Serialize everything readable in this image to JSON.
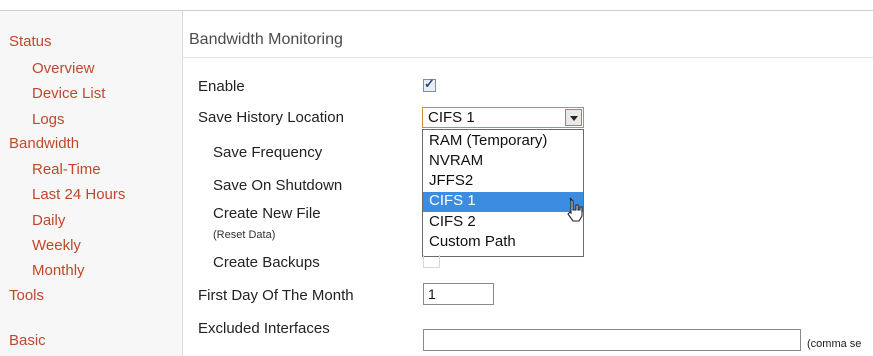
{
  "sidebar": {
    "items": [
      {
        "label": "Status"
      },
      {
        "label": "Overview"
      },
      {
        "label": "Device List"
      },
      {
        "label": "Logs"
      },
      {
        "label": "Bandwidth"
      },
      {
        "label": "Real-Time"
      },
      {
        "label": "Last 24 Hours"
      },
      {
        "label": "Daily"
      },
      {
        "label": "Weekly"
      },
      {
        "label": "Monthly"
      },
      {
        "label": "Tools"
      },
      {
        "label": "Basic"
      }
    ]
  },
  "main": {
    "section_title": "Bandwidth Monitoring",
    "fields": {
      "enable_label": "Enable",
      "enable_checked": true,
      "save_history_label": "Save History Location",
      "save_frequency_label": "Save Frequency",
      "save_on_shutdown_label": "Save On Shutdown",
      "create_new_file_label": "Create New File",
      "create_new_file_sub": "(Reset Data)",
      "create_backups_label": "Create Backups",
      "first_day_label": "First Day Of The Month",
      "first_day_value": "1",
      "excluded_label": "Excluded Interfaces",
      "excluded_value": "",
      "excluded_hint": "(comma se"
    },
    "save_history_select": {
      "selected": "CIFS 1",
      "options": [
        "RAM (Temporary)",
        "NVRAM",
        "JFFS2",
        "CIFS 1",
        "CIFS 2",
        "Custom Path"
      ],
      "highlighted_index": 3
    }
  },
  "colors": {
    "nav_link": "#c0482a",
    "highlight": "#3a8de0",
    "select_focus_border": "#d08a3c"
  }
}
